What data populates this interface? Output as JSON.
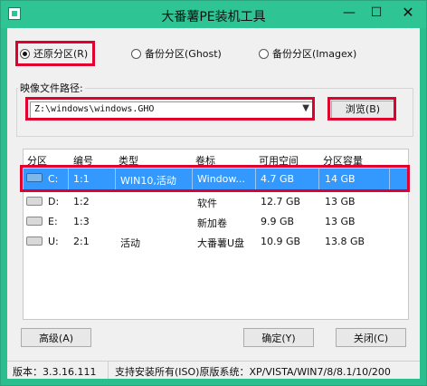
{
  "window": {
    "title": "大番薯PE装机工具"
  },
  "titlebar": {
    "minimize": "—",
    "maximize": "☐",
    "close": "✕"
  },
  "modes": [
    {
      "label": "还原分区(R)",
      "selected": true
    },
    {
      "label": "备份分区(Ghost)",
      "selected": false
    },
    {
      "label": "备份分区(Imagex)",
      "selected": false
    }
  ],
  "image_path": {
    "label": "映像文件路径:",
    "value": "Z:\\windows\\windows.GHO",
    "browse": "浏览(B)"
  },
  "table": {
    "headers": [
      "分区",
      "编号",
      "类型",
      "卷标",
      "可用空间",
      "分区容量"
    ],
    "rows": [
      {
        "drive": "C:",
        "num": "1:1",
        "type": "WIN10,活动",
        "label": "Window...",
        "free": "4.7 GB",
        "size": "14 GB",
        "selected": true
      },
      {
        "drive": "D:",
        "num": "1:2",
        "type": "",
        "label": "软件",
        "free": "12.7 GB",
        "size": "13 GB",
        "selected": false
      },
      {
        "drive": "E:",
        "num": "1:3",
        "type": "",
        "label": "新加卷",
        "free": "9.9 GB",
        "size": "13 GB",
        "selected": false
      },
      {
        "drive": "U:",
        "num": "2:1",
        "type": "活动",
        "label": "大番薯U盘",
        "free": "10.9 GB",
        "size": "13.8 GB",
        "selected": false
      }
    ]
  },
  "buttons": {
    "advanced": "高级(A)",
    "ok": "确定(Y)",
    "close": "关闭(C)"
  },
  "status": {
    "version": "版本：3.3.16.111",
    "support": "支持安装所有(ISO)原版系统：XP/VISTA/WIN7/8/8.1/10/200"
  },
  "colors": {
    "titlebar": "#2ec493",
    "highlight_red": "#e0002d",
    "selection": "#3399ff"
  }
}
